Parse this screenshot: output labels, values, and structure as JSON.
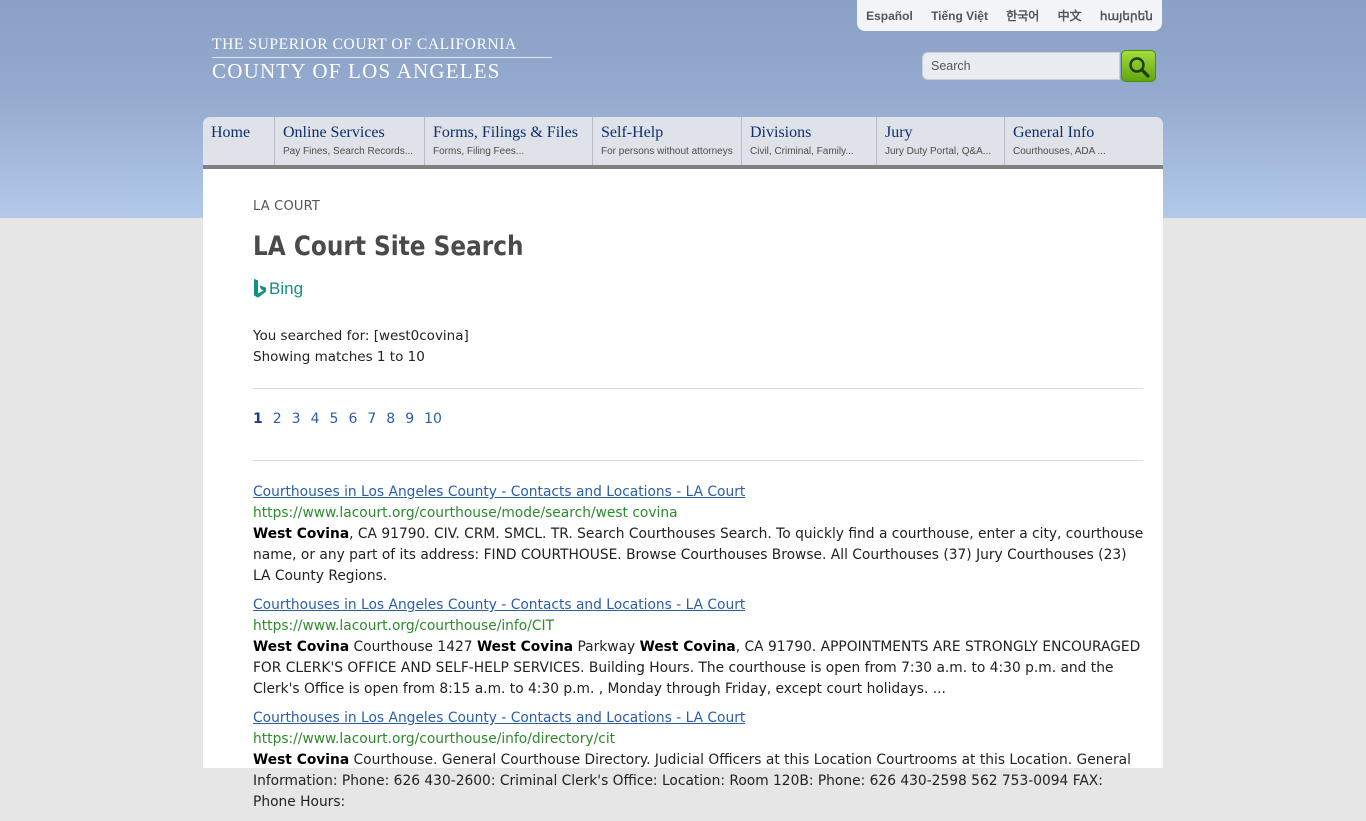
{
  "header": {
    "languages": [
      "Español",
      "Tiếng Việt",
      "한국어",
      "中文",
      "հայերեն"
    ],
    "logo_line1": "THE SUPERIOR COURT OF CALIFORNIA",
    "logo_line2": "COUNTY OF LOS ANGELES",
    "search_placeholder": "Search",
    "search_icon": "magnifier-icon"
  },
  "nav": [
    {
      "title": "Home",
      "sub": ""
    },
    {
      "title": "Online Services",
      "sub": "Pay Fines, Search Records..."
    },
    {
      "title": "Forms, Filings & Files",
      "sub": "Forms, Filing Fees..."
    },
    {
      "title": "Self-Help",
      "sub": "For persons without attorneys"
    },
    {
      "title": "Divisions",
      "sub": "Civil, Criminal, Family..."
    },
    {
      "title": "Jury",
      "sub": "Jury Duty Portal, Q&A..."
    },
    {
      "title": "General Info",
      "sub": "Courthouses, ADA ..."
    }
  ],
  "main": {
    "breadcrumb": "LA COURT",
    "title": "LA Court Site Search",
    "bing_label": "Bing",
    "searched_for": "You searched for: [west0covina]",
    "showing": "Showing matches 1 to 10",
    "pages": [
      "1",
      "2",
      "3",
      "4",
      "5",
      "6",
      "7",
      "8",
      "9",
      "10"
    ],
    "current_page": "1"
  },
  "results": [
    {
      "title": "Courthouses in Los Angeles County - Contacts and Locations - LA Court",
      "url": "https://www.lacourt.org/courthouse/mode/search/west covina",
      "snippet": [
        {
          "b": true,
          "t": "West Covina"
        },
        {
          "b": false,
          "t": ", CA 91790. CIV. CRM. SMCL. TR. Search Courthouses Search. To quickly find a courthouse, enter a city, courthouse name, or any part of its address: FIND COURTHOUSE. Browse Courthouses Browse. All Courthouses (37) Jury Courthouses (23) LA County Regions."
        }
      ]
    },
    {
      "title": "Courthouses in Los Angeles County - Contacts and Locations - LA Court",
      "url": "https://www.lacourt.org/courthouse/info/CIT",
      "snippet": [
        {
          "b": true,
          "t": "West Covina"
        },
        {
          "b": false,
          "t": " Courthouse 1427 "
        },
        {
          "b": true,
          "t": "West Covina"
        },
        {
          "b": false,
          "t": " Parkway "
        },
        {
          "b": true,
          "t": "West Covina"
        },
        {
          "b": false,
          "t": ", CA 91790. APPOINTMENTS ARE STRONGLY ENCOURAGED FOR CLERK'S OFFICE AND SELF-HELP SERVICES. Building Hours. The courthouse is open from 7:30 a.m. to 4:30 p.m. and the Clerk's Office is open from 8:15 a.m. to 4:30 p.m. , Monday through Friday, except court holidays. ..."
        }
      ]
    },
    {
      "title": "Courthouses in Los Angeles County - Contacts and Locations - LA Court",
      "url": "https://www.lacourt.org/courthouse/info/directory/cit",
      "snippet": [
        {
          "b": true,
          "t": "West Covina"
        },
        {
          "b": false,
          "t": " Courthouse. General Courthouse Directory. Judicial Officers at this Location Courtrooms at this Location. General Information: Phone: 626 430-2600: Criminal Clerk's Office: Location: Room 120B: Phone: 626 430-2598 562 753-0094 FAX: Phone Hours:"
        }
      ]
    }
  ]
}
